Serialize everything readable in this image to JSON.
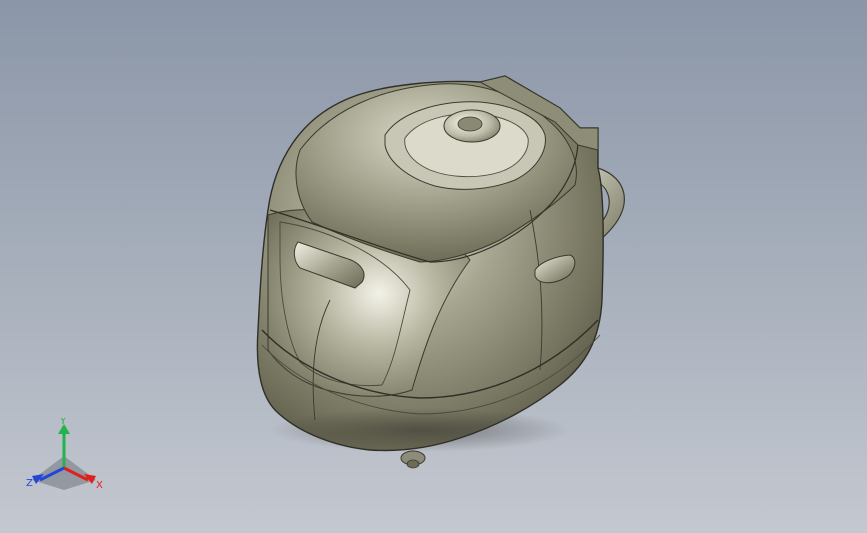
{
  "viewport": {
    "background_top": "#8b96a8",
    "background_bottom": "#c4c8d0",
    "model_subject": "rice-cooker"
  },
  "triad": {
    "x_label": "X",
    "y_label": "Y",
    "z_label": "Z",
    "x_color": "#e0201c",
    "y_color": "#22b34a",
    "z_color": "#2446d6"
  }
}
